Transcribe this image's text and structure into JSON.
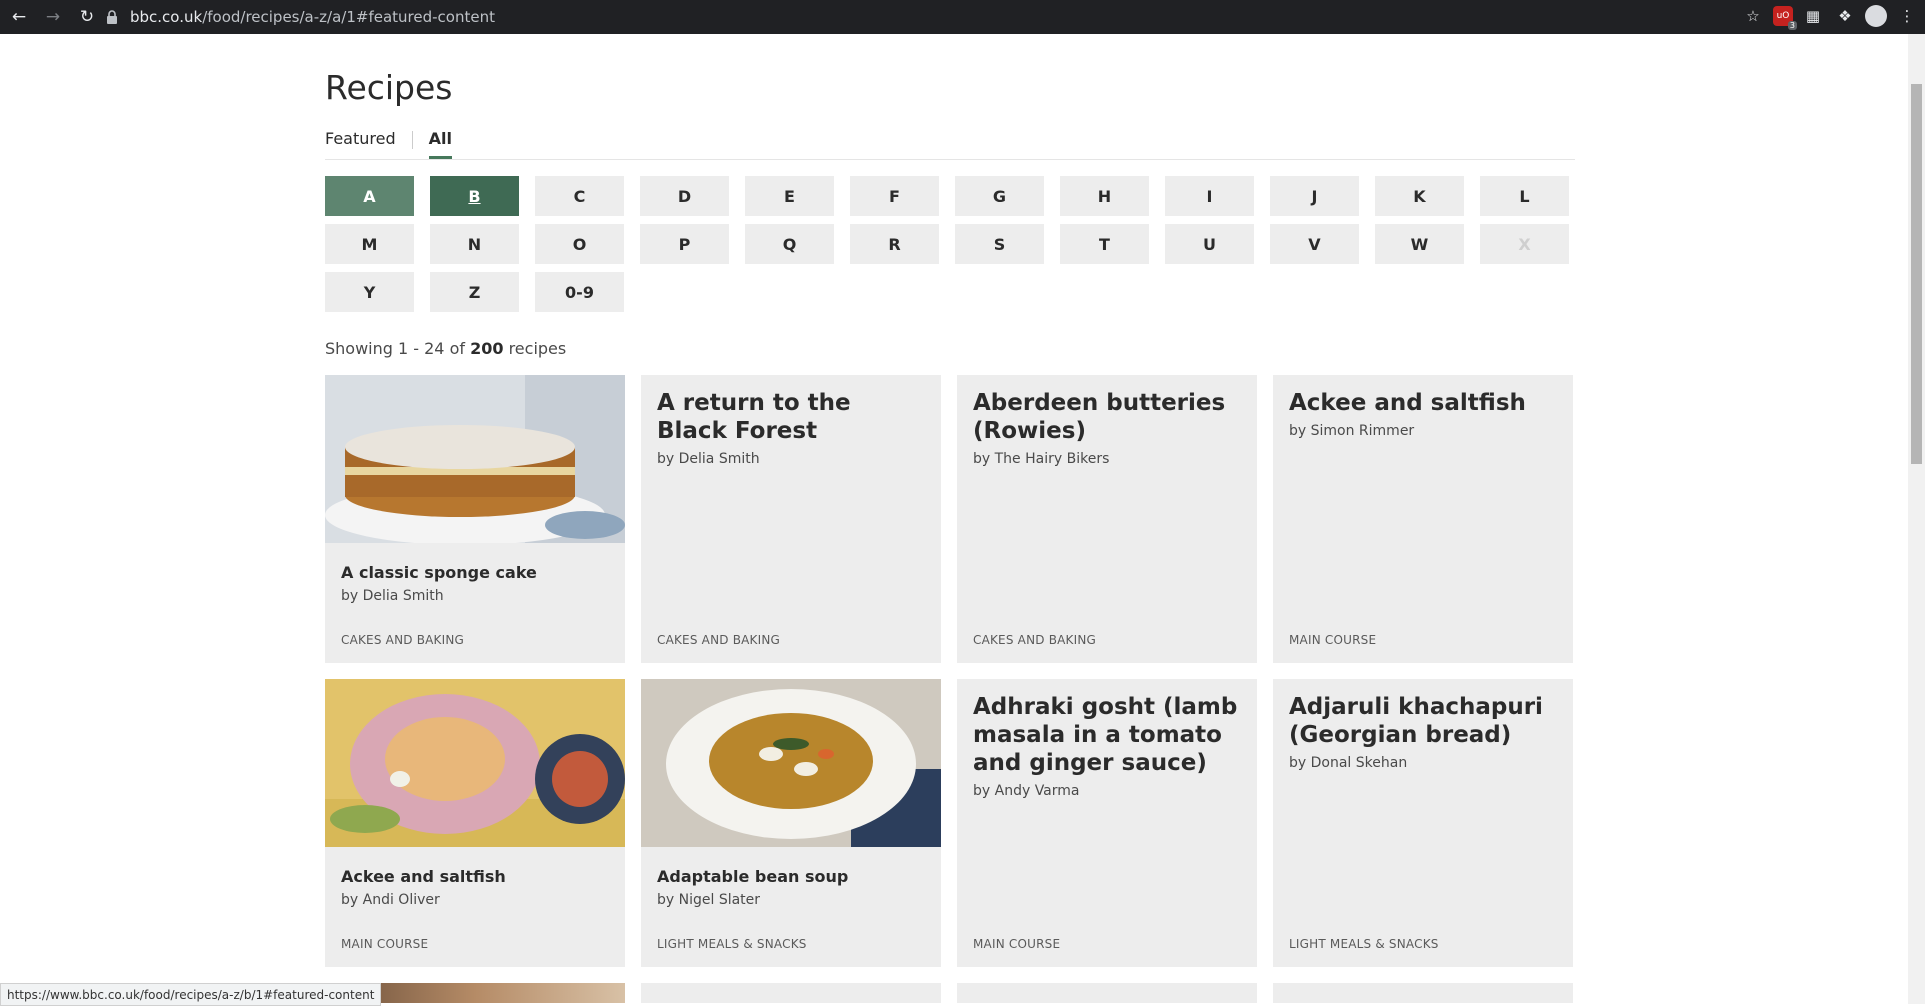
{
  "browser": {
    "url_host": "bbc.co.uk",
    "url_path": "/food/recipes/a-z/a/1#featured-content",
    "status_url": "https://www.bbc.co.uk/food/recipes/a-z/b/1#featured-content",
    "extension_badge": "3"
  },
  "page": {
    "title": "Recipes",
    "tabs": [
      {
        "label": "Featured"
      },
      {
        "label": "All"
      }
    ],
    "letters": [
      "A",
      "B",
      "C",
      "D",
      "E",
      "F",
      "G",
      "H",
      "I",
      "J",
      "K",
      "L",
      "M",
      "N",
      "O",
      "P",
      "Q",
      "R",
      "S",
      "T",
      "U",
      "V",
      "W",
      "X",
      "Y",
      "Z",
      "0-9"
    ],
    "showing_prefix": "Showing 1 - 24 of ",
    "showing_total": "200",
    "showing_suffix": " recipes"
  },
  "recipes": [
    {
      "title": "A classic sponge cake",
      "author": "by Delia Smith",
      "category": "CAKES AND BAKING"
    },
    {
      "title": "A return to the Black Forest",
      "author": "by Delia Smith",
      "category": "CAKES AND BAKING"
    },
    {
      "title": "Aberdeen butteries (Rowies)",
      "author": "by The Hairy Bikers",
      "category": "CAKES AND BAKING"
    },
    {
      "title": "Ackee and saltfish",
      "author": "by Simon Rimmer",
      "category": "MAIN COURSE"
    },
    {
      "title": "Ackee and saltfish",
      "author": "by Andi Oliver",
      "category": "MAIN COURSE"
    },
    {
      "title": "Adaptable bean soup",
      "author": "by Nigel Slater",
      "category": "LIGHT MEALS & SNACKS"
    },
    {
      "title": "Adhraki gosht (lamb masala in a tomato and ginger sauce)",
      "author": "by Andy Varma",
      "category": "MAIN COURSE"
    },
    {
      "title": "Adjaruli khachapuri (Georgian bread)",
      "author": "by Donal Skehan",
      "category": "LIGHT MEALS & SNACKS"
    }
  ]
}
